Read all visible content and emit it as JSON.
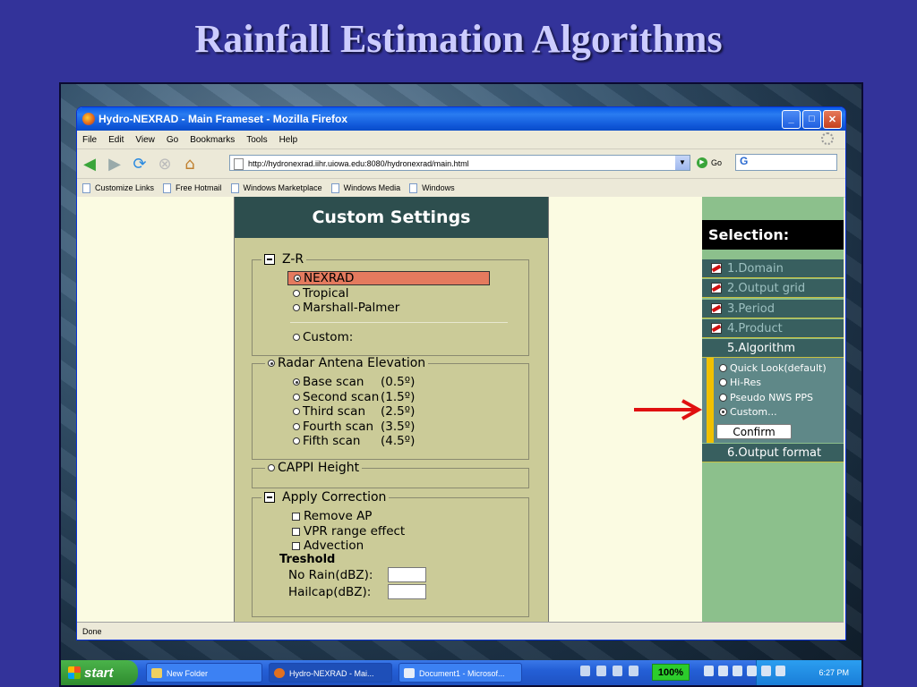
{
  "slide": {
    "title": "Rainfall Estimation Algorithms"
  },
  "window": {
    "title": "Hydro-NEXRAD - Main Frameset - Mozilla Firefox",
    "minimize": "_",
    "maximize": "□",
    "close": "✕"
  },
  "menu": [
    "File",
    "Edit",
    "View",
    "Go",
    "Bookmarks",
    "Tools",
    "Help"
  ],
  "nav": {
    "url": "http://hydronexrad.iihr.uiowa.edu:8080/hydronexrad/main.html",
    "go_label": "Go",
    "search_value": "G"
  },
  "links": [
    "Customize Links",
    "Free Hotmail",
    "Windows Marketplace",
    "Windows Media",
    "Windows"
  ],
  "settings": {
    "header": "Custom Settings",
    "zr": {
      "legend": "Z-R",
      "options": [
        "NEXRAD",
        "Tropical",
        "Marshall-Palmer"
      ],
      "custom": "Custom:"
    },
    "radar": {
      "legend": "Radar Antena Elevation",
      "scans": [
        {
          "name": "Base scan",
          "angle": "(0.5º)"
        },
        {
          "name": "Second scan",
          "angle": "(1.5º)"
        },
        {
          "name": "Third scan",
          "angle": "(2.5º)"
        },
        {
          "name": "Fourth scan",
          "angle": "(3.5º)"
        },
        {
          "name": "Fifth scan",
          "angle": "(4.5º)"
        }
      ]
    },
    "cappi": {
      "legend": "CAPPI Height"
    },
    "correction": {
      "legend": "Apply Correction",
      "checks": [
        "Remove AP",
        "VPR range effect",
        "Advection"
      ],
      "treshold_label": "Treshold",
      "no_rain": "No Rain(dBZ):",
      "hailcap": "Hailcap(dBZ):"
    }
  },
  "selection": {
    "header": "Selection:",
    "steps": [
      "1.Domain",
      "2.Output grid",
      "3.Period",
      "4.Product"
    ],
    "algorithm": "5.Algorithm",
    "algo_options": [
      "Quick Look(default)",
      "Hi-Res",
      "Pseudo NWS PPS",
      "Custom..."
    ],
    "confirm": "Confirm",
    "output_format": "6.Output format"
  },
  "status": "Done",
  "taskbar": {
    "start": "start",
    "tasks": [
      "New Folder",
      "Hydro-NEXRAD - Mai...",
      "Document1 - Microsof..."
    ],
    "zoom": "100%",
    "clock": "6:27 PM"
  },
  "colors": {
    "highlight": "#e47a5e",
    "settings_bg": "#cbcb98",
    "header_bg": "#2d4e4e",
    "arrow": "#e01010"
  }
}
